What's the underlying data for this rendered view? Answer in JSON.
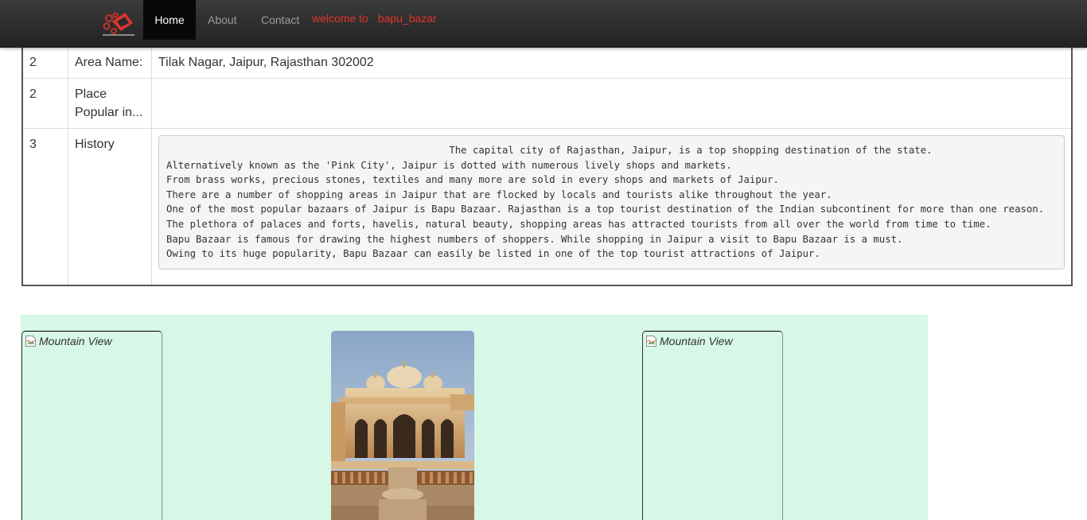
{
  "navbar": {
    "logo_icon": "bapu-bazar-logo",
    "links": [
      {
        "label": "Home",
        "active": true
      },
      {
        "label": "About",
        "active": false
      },
      {
        "label": "Contact",
        "active": false
      }
    ],
    "welcome_prefix": "welcome to",
    "welcome_name": "bapu_bazar",
    "accent_color": "#e0342b"
  },
  "table": {
    "rows": [
      {
        "num": "2",
        "label": "Area Name:",
        "value": "Tilak Nagar, Jaipur, Rajasthan 302002"
      },
      {
        "num": "2",
        "label": "Place Popular in...",
        "value": ""
      },
      {
        "num": "3",
        "label": "History"
      }
    ],
    "history_lines": [
      "                                                The capital city of Rajasthan, Jaipur, is a top shopping destination of the state.",
      "Alternatively known as the 'Pink City', Jaipur is dotted with numerous lively shops and markets.",
      "From brass works, precious stones, textiles and many more are sold in every shops and markets of Jaipur.",
      "There are a number of shopping areas in Jaipur that are flocked by locals and tourists alike throughout the year.",
      "One of the most popular bazaars of Jaipur is Bapu Bazaar. Rajasthan is a top tourist destination of the Indian subcontinent for more than one reason.",
      "The plethora of palaces and forts, havelis, natural beauty, shopping areas has attracted tourists from all over the world from time to time.",
      "Bapu Bazaar is famous for drawing the highest numbers of shoppers. While shopping in Jaipur a visit to Bapu Bazaar is a must.",
      "Owing to its huge popularity, Bapu Bazaar can easily be listed in one of the top tourist attractions of Jaipur."
    ]
  },
  "gallery": {
    "background": "#d7f8e7",
    "images": [
      {
        "alt": "Mountain View",
        "broken": true
      },
      {
        "alt": "",
        "broken": false,
        "icon": "palace-photo"
      },
      {
        "alt": "Mountain View",
        "broken": true
      }
    ]
  }
}
